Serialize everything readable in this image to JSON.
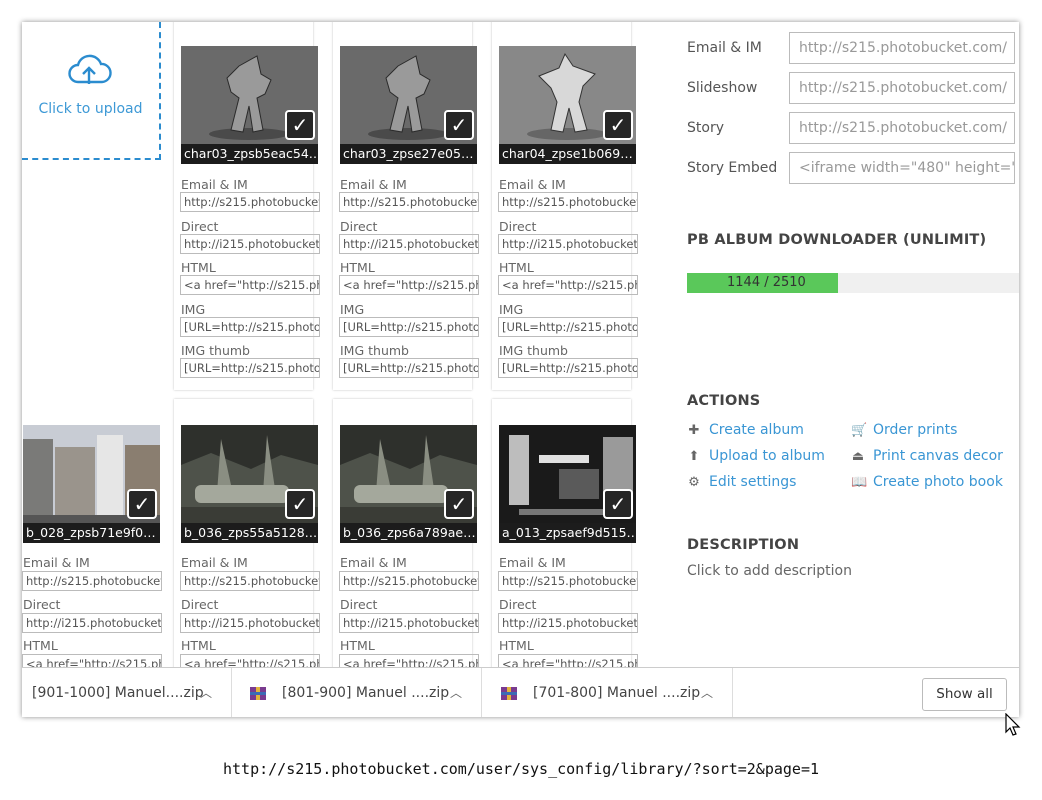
{
  "upload": {
    "label": "Click to upload"
  },
  "cards": [
    {
      "caption": "char03_zpsb5eac54…",
      "fields": [
        "http://s215.photobucket.com/",
        "http://i215.photobucket.com/",
        "<a href=\"http://s215.photob",
        "[URL=http://s215.photobucket",
        "[URL=http://s215.photobucket"
      ]
    },
    {
      "caption": "char03_zpse27e05…",
      "fields": [
        "http://s215.photobucket.com/",
        "http://i215.photobucket.com/",
        "<a href=\"http://s215.photob",
        "[URL=http://s215.photobucket",
        "[URL=http://s215.photobucket"
      ]
    },
    {
      "caption": "char04_zpse1b069…",
      "fields": [
        "http://s215.photobucket.com/",
        "http://i215.photobucket.com/",
        "<a href=\"http://s215.photob",
        "[URL=http://s215.photobucket",
        "[URL=http://s215.photobucket"
      ]
    },
    {
      "caption": "b_028_zpsb71e9f0…",
      "fields": [
        "http://s215.photobucket.com/",
        "http://i215.photobucket.com/",
        "<a href=\"http://s215.photob"
      ]
    },
    {
      "caption": "b_036_zps55a5128…",
      "fields": [
        "http://s215.photobucket.com/",
        "http://i215.photobucket.com/",
        "<a href=\"http://s215.photob"
      ]
    },
    {
      "caption": "b_036_zps6a789ae…",
      "fields": [
        "http://s215.photobucket.com/",
        "http://i215.photobucket.com/",
        "<a href=\"http://s215.photob"
      ]
    },
    {
      "caption": "a_013_zpsaef9d515…",
      "fields": [
        "http://s215.photobucket.com/",
        "http://i215.photobucket.com/",
        "<a href=\"http://s215.photob"
      ]
    }
  ],
  "field_labels": [
    "Email & IM",
    "Direct",
    "HTML",
    "IMG",
    "IMG thumb"
  ],
  "share": {
    "rows": [
      {
        "label": "Email & IM",
        "value": "http://s215.photobucket.com/"
      },
      {
        "label": "Slideshow",
        "value": "http://s215.photobucket.com/"
      },
      {
        "label": "Story",
        "value": "http://s215.photobucket.com/"
      },
      {
        "label": "Story Embed",
        "value": "<iframe width=\"480\" height=\""
      }
    ]
  },
  "downloader": {
    "title": "PB ALBUM DOWNLOADER (UNLIMIT)",
    "progress_text": "1144 / 2510",
    "progress": 0.4558
  },
  "actions": {
    "title": "ACTIONS",
    "items": [
      {
        "label": "Create album",
        "icon": "plus-icon"
      },
      {
        "label": "Upload to album",
        "icon": "upload-arrow-icon"
      },
      {
        "label": "Edit settings",
        "icon": "gear-icon"
      },
      {
        "label": "Order prints",
        "icon": "cart-icon"
      },
      {
        "label": "Print canvas decor",
        "icon": "canvas-icon"
      },
      {
        "label": "Create photo book",
        "icon": "book-icon"
      }
    ]
  },
  "description": {
    "title": "DESCRIPTION",
    "placeholder": "Click to add description"
  },
  "downloads": {
    "items": [
      "[901-1000] Manuel....zip",
      "[801-900] Manuel ....zip",
      "[701-800] Manuel ....zip"
    ],
    "show_all": "Show all"
  },
  "url": "http://s215.photobucket.com/user/sys_config/library/?sort=2&page=1",
  "colors": {
    "link": "#3a96d4",
    "progress": "#5ac85a",
    "upload_border": "#2b8ccf"
  }
}
